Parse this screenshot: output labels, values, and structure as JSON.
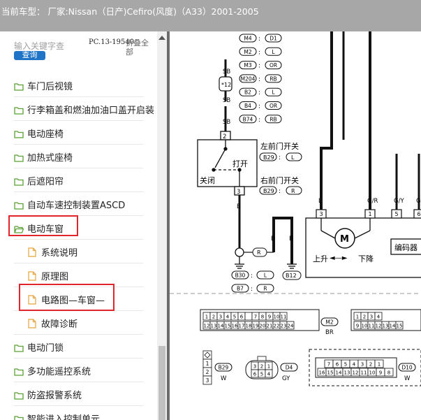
{
  "titlebar": {
    "text": "当前车型： 厂家:Nissan（日产)Cefiro(风度)（A33）2001-2005"
  },
  "search": {
    "placeholder": "输入关键字查",
    "button": "查询",
    "pc_code": "PC.13-19540",
    "collapse_all": "折叠全部"
  },
  "tree": [
    {
      "label": "车门后视镜",
      "type": "folder",
      "level": 0
    },
    {
      "label": "行李箱盖和燃油加油口盖开启装",
      "type": "folder",
      "level": 0
    },
    {
      "label": "电动座椅",
      "type": "folder",
      "level": 0
    },
    {
      "label": "加热式座椅",
      "type": "folder",
      "level": 0
    },
    {
      "label": "后遮阳帘",
      "type": "folder",
      "level": 0
    },
    {
      "label": "自动车速控制装置ASCD",
      "type": "folder",
      "level": 0
    },
    {
      "label": "电动车窗",
      "type": "folder-open",
      "level": 0,
      "highlighted": true
    },
    {
      "label": "系统说明",
      "type": "doc",
      "level": 1
    },
    {
      "label": "原理图",
      "type": "doc",
      "level": 1
    },
    {
      "label": "电路图—车窗—",
      "type": "doc",
      "level": 1,
      "highlighted": true
    },
    {
      "label": "故障诊断",
      "type": "doc",
      "level": 1
    },
    {
      "label": "电动门锁",
      "type": "folder",
      "level": 0
    },
    {
      "label": "多功能遥控系统",
      "type": "folder",
      "level": 0
    },
    {
      "label": "防盗报警系统",
      "type": "folder",
      "level": 0
    },
    {
      "label": "智能进入控制单元",
      "type": "folder",
      "level": 0
    }
  ],
  "diagram": {
    "top_connectors": [
      {
        "a": "M4",
        "b": "D1"
      },
      {
        "a": "M2",
        "b": "L"
      },
      {
        "a": "M3",
        "b": "OR"
      },
      {
        "a": "M204",
        "b": "RB"
      },
      {
        "a": "B2",
        "b": "L"
      },
      {
        "a": "B4",
        "b": "OR"
      },
      {
        "a": "B74",
        "b": "RB"
      }
    ],
    "wire_sb": "SB",
    "wire_b": "B",
    "fuse_label": "*12",
    "switch_pin_top": "2",
    "switch_pin_bottom": "3",
    "switch_open": "打开",
    "switch_close": "关闭",
    "front_left_switch": "左前门开关",
    "front_left_conn": "B29",
    "front_left_pin": "L",
    "front_right_switch": "右前门开关",
    "front_right_conn": "B29",
    "front_right_pin": "R",
    "ground_r": "R",
    "ground_conns": [
      {
        "a": "B30",
        "b": "L"
      },
      {
        "a": "B7",
        "b": "R"
      }
    ],
    "b12": "B12",
    "wire_labels": [
      "L",
      "G/R",
      "G/Y",
      "G"
    ],
    "motor_pins": [
      "3",
      "1",
      "5",
      "6"
    ],
    "motor": "M",
    "motor_up": "上升",
    "motor_down": "下降",
    "encoder": "编码器",
    "m2_pins_row1": [
      "1",
      "2",
      "3",
      "4",
      "5",
      "6",
      "",
      "7",
      "8",
      "9",
      "10",
      "11"
    ],
    "m2_pins_row2": [
      "12",
      "13",
      "14",
      "15",
      "16",
      "17",
      "18",
      "19",
      "20",
      "21",
      "22",
      "23",
      "24"
    ],
    "m2_label": "M2",
    "m2_color": "BR",
    "r2_pins_row1": [
      "1",
      "2",
      "3",
      "4"
    ],
    "r2_pins_row2": [
      "9",
      "10",
      "11",
      "12",
      "13",
      "14",
      "15"
    ],
    "b29_label": "B29",
    "b29_color": "W",
    "b29_pins": [
      "1",
      "2",
      "3"
    ],
    "d4_label": "D4",
    "d4_color": "GY",
    "d4_pins_top": [
      "3",
      "2",
      "1"
    ],
    "d4_pins_bot": [
      "6",
      "5",
      "4"
    ],
    "d10_label": "D10",
    "d10_color": "W",
    "d10_pins_row1": [
      "7",
      "6",
      "5",
      "4",
      "3",
      "2",
      "1"
    ],
    "d10_pins_row2": [
      "16",
      "15",
      "14",
      "13",
      "12",
      "11",
      "10",
      "9",
      "8"
    ]
  },
  "colors": {
    "highlight": "#e0262a",
    "titlebar": "#a7a7a7",
    "folder": "#5aa035",
    "doc": "#e8a33a",
    "button": "#1f74c7"
  }
}
